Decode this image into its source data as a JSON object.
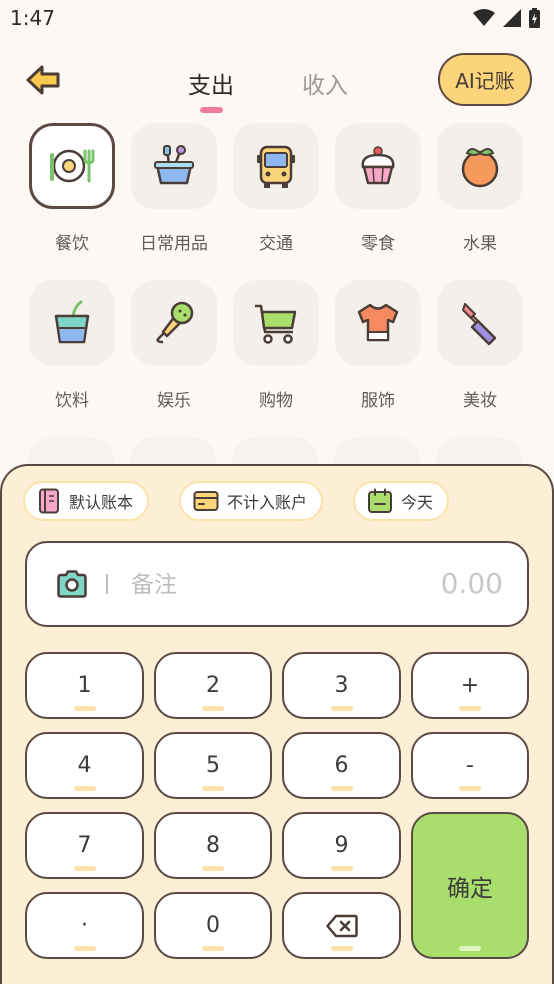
{
  "status_bar": {
    "time": "1:47"
  },
  "header": {
    "tabs": [
      {
        "label": "支出"
      },
      {
        "label": "收入"
      }
    ],
    "ai_button": "AI记账"
  },
  "categories": [
    {
      "label": "餐饮",
      "icon": "dining-icon",
      "selected": true
    },
    {
      "label": "日常用品",
      "icon": "daily-goods-icon"
    },
    {
      "label": "交通",
      "icon": "bus-icon"
    },
    {
      "label": "零食",
      "icon": "cupcake-icon"
    },
    {
      "label": "水果",
      "icon": "fruit-icon"
    },
    {
      "label": "饮料",
      "icon": "drink-icon"
    },
    {
      "label": "娱乐",
      "icon": "microphone-icon"
    },
    {
      "label": "购物",
      "icon": "shopping-cart-icon"
    },
    {
      "label": "服饰",
      "icon": "clothing-icon"
    },
    {
      "label": "美妆",
      "icon": "lipstick-icon"
    }
  ],
  "panel": {
    "chips": [
      {
        "label": "默认账本",
        "icon": "book-icon"
      },
      {
        "label": "不计入账户",
        "icon": "wallet-icon"
      },
      {
        "label": "今天",
        "icon": "calendar-icon"
      }
    ],
    "note": {
      "placeholder": "备注",
      "amount": "0.00"
    },
    "keys": {
      "k1": "1",
      "k2": "2",
      "k3": "3",
      "plus": "+",
      "k4": "4",
      "k5": "5",
      "k6": "6",
      "minus": "-",
      "k7": "7",
      "k8": "8",
      "k9": "9",
      "confirm": "确定",
      "dot": "·",
      "k0": "0",
      "backspace_icon": "backspace-icon"
    }
  },
  "colors": {
    "accent_pink": "#f07aa0",
    "ai_yellow": "#fcd479",
    "panel_bg": "#fdefd6",
    "confirm_green": "#a9de6c",
    "outline": "#5b4a44"
  }
}
